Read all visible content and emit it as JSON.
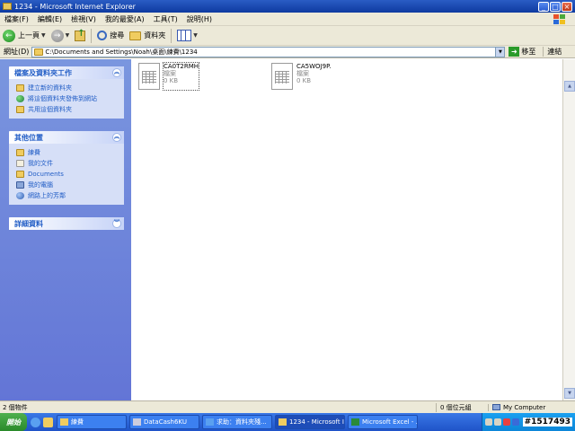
{
  "window": {
    "title": "1234 - Microsoft Internet Explorer"
  },
  "menu": [
    "檔案(F)",
    "編輯(E)",
    "檢視(V)",
    "我的最愛(A)",
    "工具(T)",
    "說明(H)"
  ],
  "toolbar": {
    "back": "上一頁",
    "search": "搜尋",
    "folders": "資料夾"
  },
  "address": {
    "label": "網址(D)",
    "value": "C:\\Documents and Settings\\Noah\\桌面\\練費\\1234",
    "go": "移至",
    "links": "連結"
  },
  "tasks_panel": {
    "title": "檔案及資料夾工作",
    "items": [
      "建立新的資料夾",
      "將這個資料夾發佈到網站",
      "共用這個資料夾"
    ]
  },
  "places_panel": {
    "title": "其他位置",
    "items": [
      "練費",
      "我的文件",
      "Documents",
      "我的電腦",
      "網路上的芳鄰"
    ]
  },
  "details_panel": {
    "title": "詳細資料"
  },
  "files": [
    {
      "name": "CA0T2RMH",
      "type": "檔案",
      "size": "0 KB"
    },
    {
      "name": "CA5WOJ9P.",
      "type": "檔案",
      "size": "0 KB"
    }
  ],
  "status": {
    "objects": "2 個物件",
    "size": "0 個位元組",
    "location": "My Computer"
  },
  "taskbar": {
    "start": "開始",
    "tasks": [
      "練費",
      "DataCash6KU",
      "求助：資料夾殘...",
      "1234 - Microsoft I...",
      "Microsoft Excel - ..."
    ],
    "clock": "#1517493"
  }
}
